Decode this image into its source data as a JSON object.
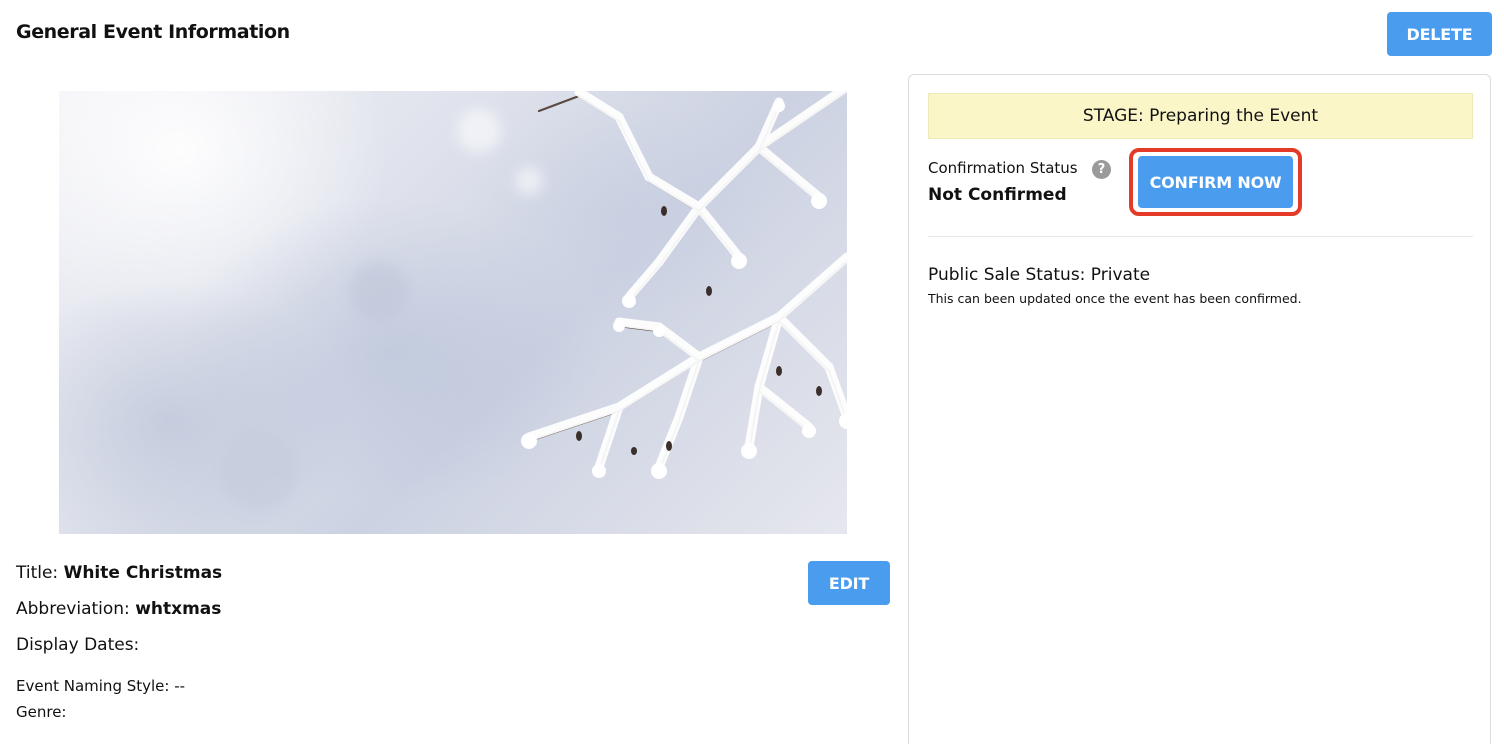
{
  "header": {
    "title": "General Event Information",
    "delete_label": "DELETE"
  },
  "hero_image": {
    "alt": "Snow-covered branches on a pale winter background"
  },
  "details": {
    "title_label": "Title:",
    "title_value": "White Christmas",
    "abbreviation_label": "Abbreviation:",
    "abbreviation_value": "whtxmas",
    "display_dates_label": "Display Dates:",
    "naming_style_label": "Event Naming Style:",
    "naming_style_value": "--",
    "genre_label": "Genre:",
    "edit_label": "EDIT"
  },
  "status_panel": {
    "stage_text": "STAGE: Preparing the Event",
    "confirmation_label": "Confirmation Status",
    "help_icon": "question-circle-icon",
    "confirmation_value": "Not Confirmed",
    "confirm_label": "CONFIRM NOW",
    "public_sale_status": "Public Sale Status: Private",
    "public_sale_note": "This can been updated once the event has been confirmed."
  },
  "colors": {
    "accent": "#4a9cee",
    "highlight_border": "#e33b27",
    "stage_banner_bg": "#fbf6c8"
  }
}
